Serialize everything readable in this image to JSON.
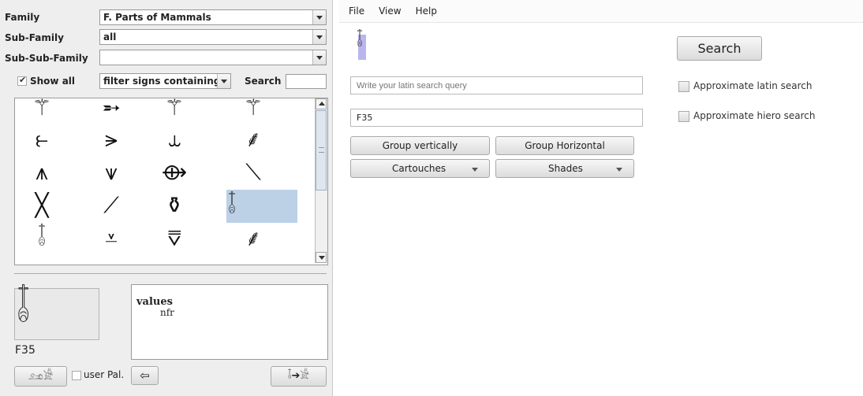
{
  "left_panel": {
    "family": {
      "label": "Family",
      "value": "F. Parts of Mammals"
    },
    "sub_family": {
      "label": "Sub-Family",
      "value": "all"
    },
    "sub_sub_family": {
      "label": "Sub-Sub-Family",
      "value": ""
    },
    "show_all": {
      "label": "Show all",
      "checked": true
    },
    "filter": {
      "value": "filter signs containing",
      "search_label": "Search",
      "search_value": ""
    },
    "sign_grid": {
      "rows": [
        [
          "⚚",
          "➵",
          "⚚",
          "⚚"
        ],
        [
          "⥼",
          "⪫",
          "⥿",
          "⸙"
        ],
        [
          "⩚",
          "⩛",
          "⟴",
          "⟍"
        ],
        [
          "╳",
          "⟋",
          "⚱",
          "𓄤"
        ],
        [
          "𓄤",
          "⩡",
          "⩢",
          "⸙"
        ]
      ],
      "selected_index": 15
    },
    "preview": {
      "glyph": "𓄤",
      "code": "F35"
    },
    "info": {
      "title": "values",
      "value": "nfr"
    },
    "bottom_bar": {
      "user_pal_label": "user Pal.",
      "user_pal_checked": false,
      "btn1_glyph": "𓃭𓀀",
      "back_glyph": "⇦",
      "insert_glyph": "𓄤➔𓀀"
    }
  },
  "right_panel": {
    "menu": [
      "File",
      "View",
      "Help"
    ],
    "result_glyph": "𓄤",
    "search_button": "Search",
    "latin_input": {
      "value": "",
      "placeholder": "Write your latin search query"
    },
    "hiero_input": {
      "value": "F35"
    },
    "approx_latin": {
      "label": "Approximate latin search",
      "checked": false
    },
    "approx_hiero": {
      "label": "Approximate hiero search",
      "checked": false
    },
    "group_vertical": "Group vertically",
    "group_horizontal": "Group Horizontal",
    "cartouches": "Cartouches",
    "shades": "Shades"
  }
}
